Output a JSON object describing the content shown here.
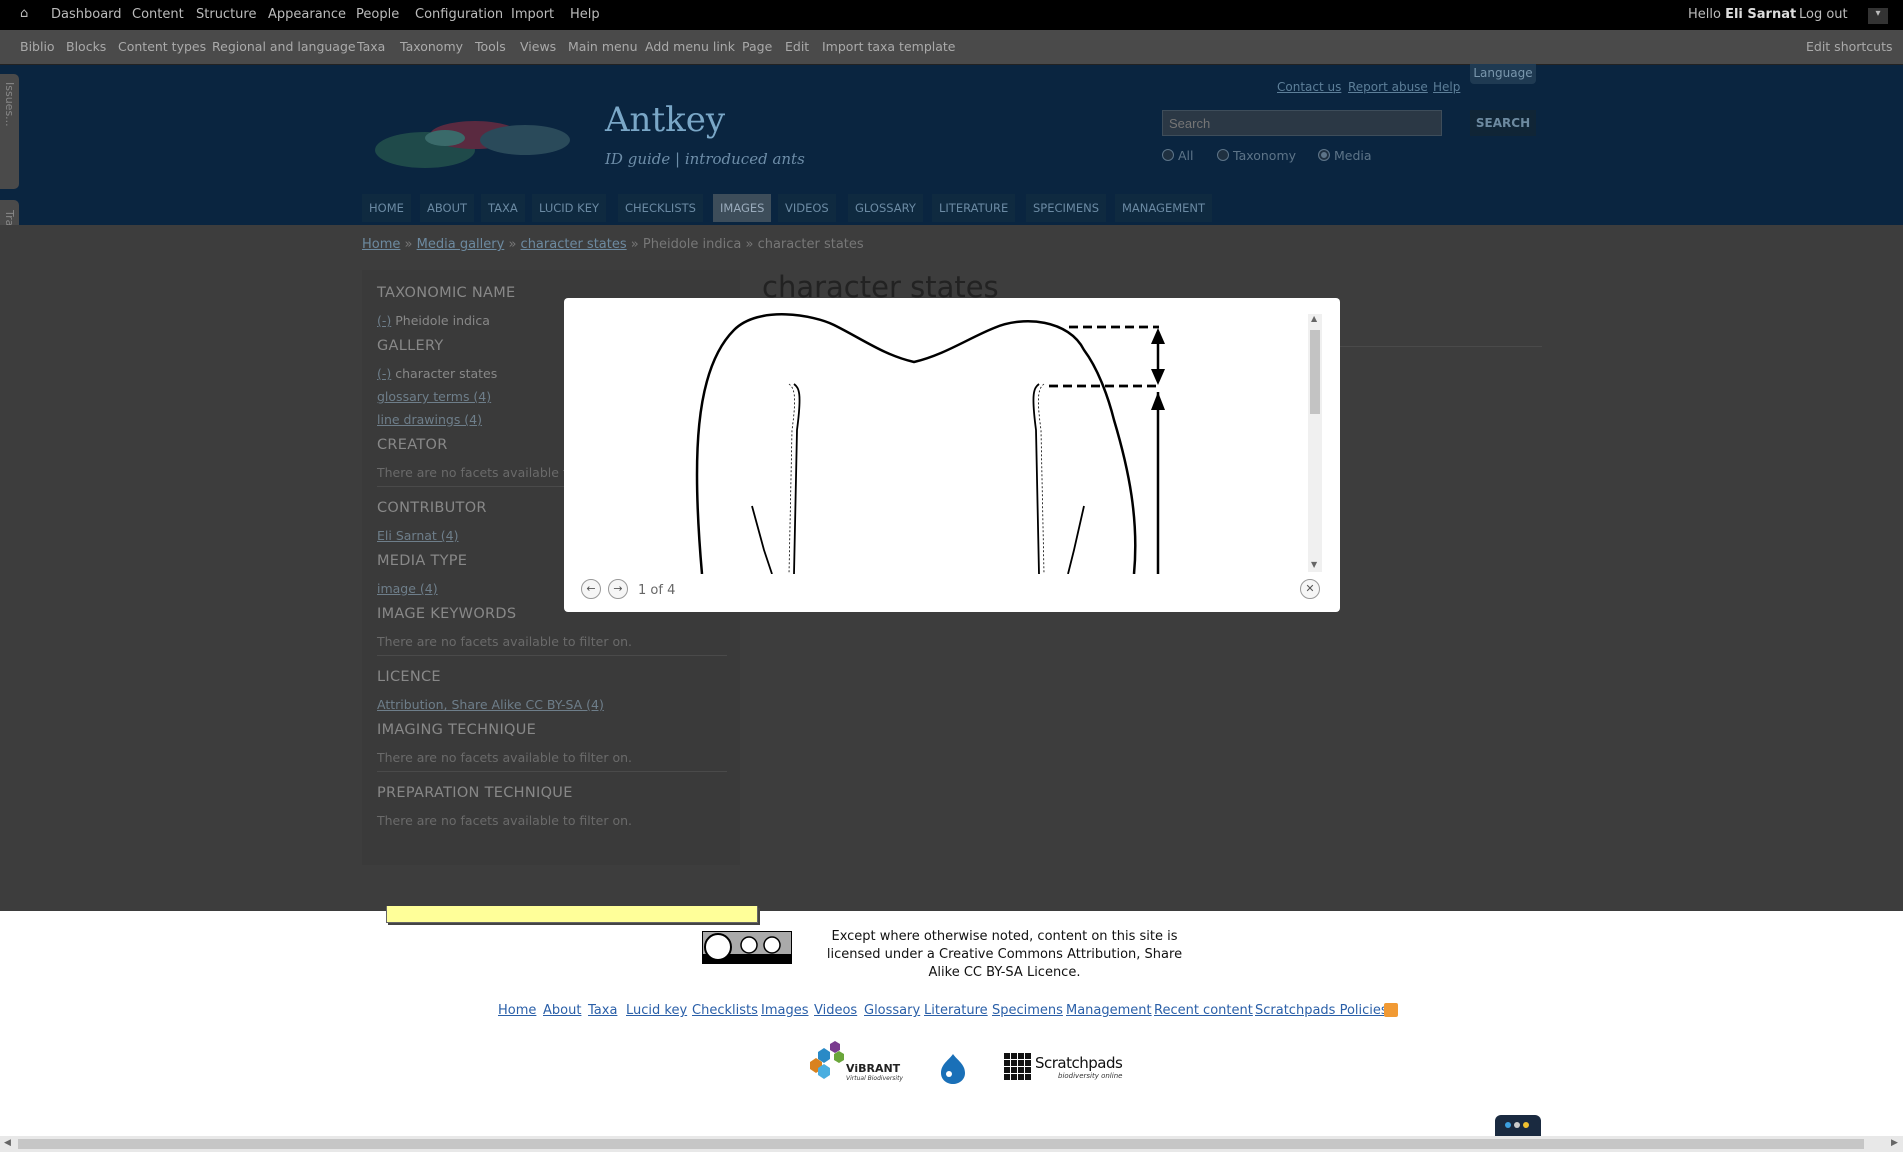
{
  "admin_toolbar": {
    "items": [
      "Dashboard",
      "Content",
      "Structure",
      "Appearance",
      "People",
      "Configuration",
      "Import",
      "Help"
    ],
    "greeting": "Hello",
    "user": "Eli Sarnat",
    "logout": "Log out"
  },
  "shortcut_bar": {
    "items": [
      "Biblio",
      "Blocks",
      "Content types",
      "Regional and language",
      "Taxa",
      "Taxonomy",
      "Tools",
      "Views",
      "Main menu",
      "Add menu link",
      "Page",
      "Edit",
      "Import taxa template"
    ],
    "edit_shortcuts": "Edit shortcuts"
  },
  "side_tabs": {
    "issues": "Issues...",
    "translate": "Translate..."
  },
  "header": {
    "site_name": "Antkey",
    "slogan": "ID guide | introduced ants",
    "top_links": [
      "Contact us",
      "Report abuse",
      "Help"
    ],
    "language": "Language",
    "search": {
      "placeholder": "Search",
      "button": "SEARCH",
      "options": [
        "All",
        "Taxonomy",
        "Media"
      ],
      "selected": "Media"
    }
  },
  "nav": {
    "tabs": [
      "HOME",
      "ABOUT",
      "TAXA",
      "LUCID KEY",
      "CHECKLISTS",
      "IMAGES",
      "VIDEOS",
      "GLOSSARY",
      "LITERATURE",
      "SPECIMENS",
      "MANAGEMENT"
    ],
    "active": "IMAGES"
  },
  "breadcrumb": {
    "links": [
      "Home",
      "Media gallery",
      "character states"
    ],
    "current": "Pheidole indica » character states",
    "sep": "»"
  },
  "page_title": "character states",
  "facets": {
    "taxonomic_name": {
      "title": "TAXONOMIC NAME",
      "remove": "(-)",
      "value": "Pheidole indica"
    },
    "gallery": {
      "title": "GALLERY",
      "remove": "(-)",
      "value": "character states",
      "links": [
        "glossary terms (4)",
        "line drawings (4)"
      ]
    },
    "creator": {
      "title": "CREATOR",
      "empty": "There are no facets available to"
    },
    "contributor": {
      "title": "CONTRIBUTOR",
      "links": [
        "Eli Sarnat (4)"
      ]
    },
    "media_type": {
      "title": "MEDIA TYPE",
      "links": [
        "image (4)"
      ]
    },
    "image_keywords": {
      "title": "IMAGE KEYWORDS",
      "empty": "There are no facets available to filter on."
    },
    "licence": {
      "title": "LICENCE",
      "links": [
        "Attribution, Share Alike CC BY-SA (4)"
      ]
    },
    "imaging_technique": {
      "title": "IMAGING TECHNIQUE",
      "empty": "There are no facets available to filter on."
    },
    "preparation_technique": {
      "title": "PREPARATION TECHNIQUE",
      "empty": "There are no facets available to filter on."
    }
  },
  "modal": {
    "counter": "1 of 4"
  },
  "footer": {
    "licence_text": "Except where otherwise noted, content on this site is licensed under a Creative Commons Attribution, Share Alike CC BY-SA Licence.",
    "links": [
      "Home",
      "About",
      "Taxa",
      "Lucid key",
      "Checklists",
      "Images",
      "Videos",
      "Glossary",
      "Literature",
      "Specimens",
      "Management",
      "Recent content",
      "Scratchpads Policies"
    ],
    "logos": {
      "vibrant": "ViBRANT",
      "vibrant_sub": "Virtual Biodiversity",
      "scratchpads": "Scratchpads",
      "scratchpads_sub": "biodiversity online"
    }
  },
  "colors": {
    "header_bg": "#0a2540",
    "active_tab": "#3d4d5a",
    "footer_link": "#2a5fa8"
  }
}
